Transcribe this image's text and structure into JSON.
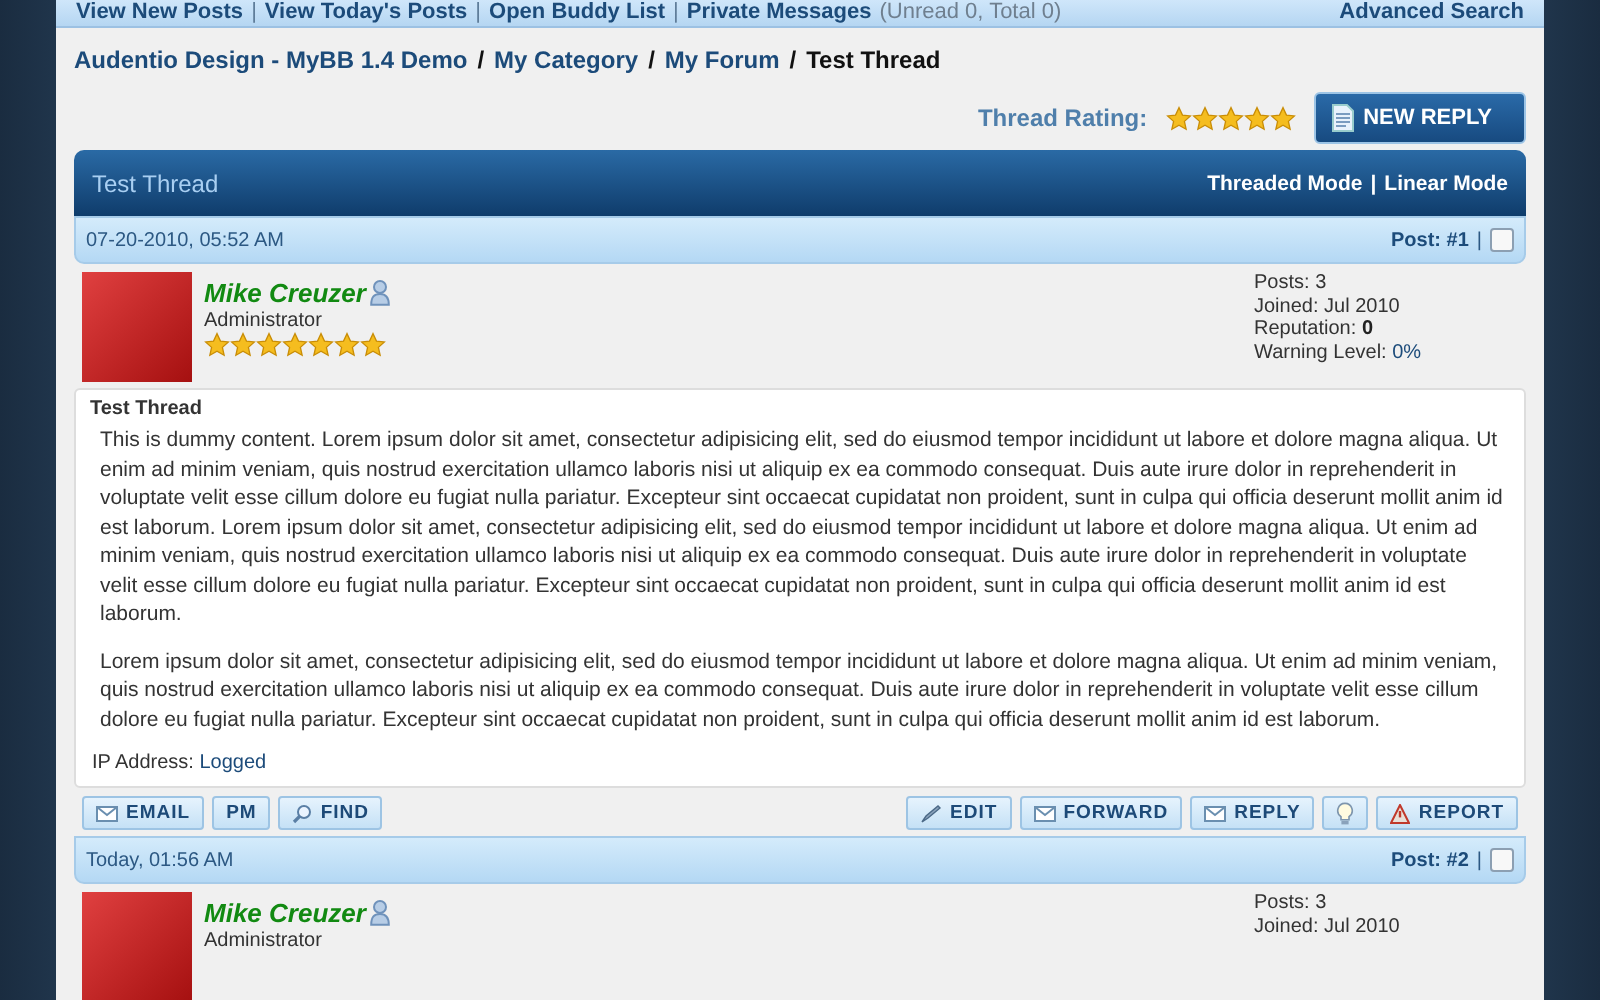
{
  "nav": {
    "links": [
      "View New Posts",
      "View Today's Posts",
      "Open Buddy List",
      "Private Messages"
    ],
    "separator": "|",
    "pm_counts": "(Unread 0, Total 0)",
    "right_link": "Advanced Search"
  },
  "breadcrumb": {
    "items": [
      "Audentio Design - MyBB 1.4 Demo",
      "My Category",
      "My Forum",
      "Test Thread"
    ],
    "separator": "/"
  },
  "thread_rating": {
    "label": "Thread Rating:",
    "stars": 5
  },
  "new_reply_button": "NEW REPLY",
  "thread": {
    "title": "Test Thread",
    "modes": [
      "Threaded Mode",
      "Linear Mode"
    ],
    "separator": "|"
  },
  "posts": [
    {
      "date": "07-20-2010, 05:52 AM",
      "post_number": "Post: #1",
      "separator": "|",
      "checked": false,
      "author": {
        "name": "Mike Creuzer",
        "group": "Administrator",
        "stars": 7
      },
      "stats": [
        {
          "label": "Posts:",
          "value": "3",
          "kind": "plain"
        },
        {
          "label": "Joined:",
          "value": "Jul 2010",
          "kind": "plain"
        },
        {
          "label": "Reputation:",
          "value": "0",
          "kind": "bold"
        },
        {
          "label": "Warning Level:",
          "value": "0%",
          "kind": "link"
        }
      ],
      "subject": "Test Thread",
      "paragraphs": [
        "This is dummy content. Lorem ipsum dolor sit amet, consectetur adipisicing elit, sed do eiusmod tempor incididunt ut labore et dolore magna aliqua. Ut enim ad minim veniam, quis nostrud exercitation ullamco laboris nisi ut aliquip ex ea commodo consequat. Duis aute irure dolor in reprehenderit in voluptate velit esse cillum dolore eu fugiat nulla pariatur. Excepteur sint occaecat cupidatat non proident, sunt in culpa qui officia deserunt mollit anim id est laborum. Lorem ipsum dolor sit amet, consectetur adipisicing elit, sed do eiusmod tempor incididunt ut labore et dolore magna aliqua. Ut enim ad minim veniam, quis nostrud exercitation ullamco laboris nisi ut aliquip ex ea commodo consequat. Duis aute irure dolor in reprehenderit in voluptate velit esse cillum dolore eu fugiat nulla pariatur. Excepteur sint occaecat cupidatat non proident, sunt in culpa qui officia deserunt mollit anim id est laborum.",
        "Lorem ipsum dolor sit amet, consectetur adipisicing elit, sed do eiusmod tempor incididunt ut labore et dolore magna aliqua. Ut enim ad minim veniam, quis nostrud exercitation ullamco laboris nisi ut aliquip ex ea commodo consequat. Duis aute irure dolor in reprehenderit in voluptate velit esse cillum dolore eu fugiat nulla pariatur. Excepteur sint occaecat cupidatat non proident, sunt in culpa qui officia deserunt mollit anim id est laborum."
      ],
      "ip_label": "IP Address:",
      "ip_value": "Logged",
      "left_buttons": [
        {
          "kind": "email",
          "label": "EMAIL"
        },
        {
          "kind": "pm",
          "label": "PM"
        },
        {
          "kind": "find",
          "label": "FIND"
        }
      ],
      "right_buttons": [
        {
          "kind": "edit",
          "label": "EDIT"
        },
        {
          "kind": "forward",
          "label": "FORWARD"
        },
        {
          "kind": "reply",
          "label": "REPLY"
        },
        {
          "kind": "rate"
        },
        {
          "kind": "report",
          "label": "REPORT"
        }
      ]
    },
    {
      "date": "Today, 01:56 AM",
      "post_number": "Post: #2",
      "separator": "|",
      "checked": false,
      "author": {
        "name": "Mike Creuzer",
        "group": "Administrator"
      },
      "stats": [
        {
          "label": "Posts:",
          "value": "3",
          "kind": "plain"
        },
        {
          "label": "Joined:",
          "value": "Jul 2010",
          "kind": "plain"
        }
      ]
    }
  ]
}
